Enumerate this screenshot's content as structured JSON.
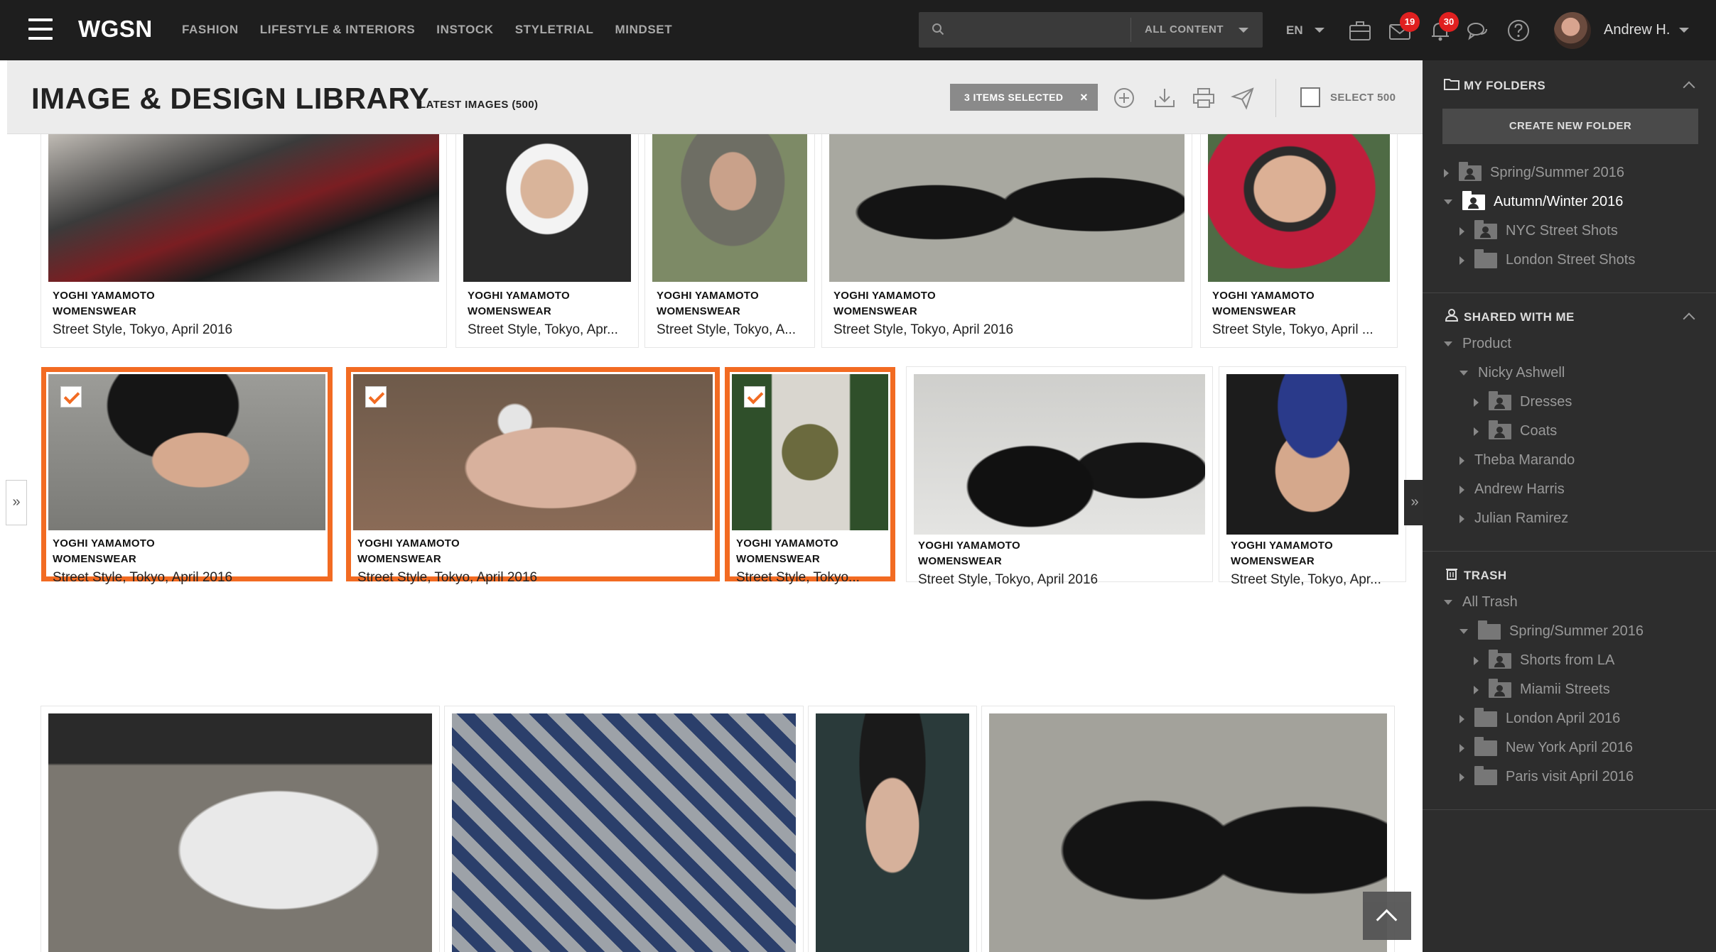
{
  "topbar": {
    "logo": "WGSN",
    "nav": [
      "FASHION",
      "LIFESTYLE & INTERIORS",
      "INSTOCK",
      "STYLETRIAL",
      "MINDSET"
    ],
    "search_placeholder": "",
    "search_scope": "ALL CONTENT",
    "language": "EN",
    "mail_badge": "19",
    "notifications_badge": "30",
    "user_name": "Andrew H.",
    "badge_color": "#e02020"
  },
  "library": {
    "title": "IMAGE & DESIGN LIBRARY",
    "subtitle": "LATEST IMAGES (500)",
    "selected_label": "3 ITEMS SELECTED",
    "select_all_label": "SELECT 500",
    "selection_color": "#f26b22"
  },
  "cards": [
    {
      "brand": "YOGHI YAMAMOTO",
      "category": "WOMENSWEAR",
      "caption": "Street Style, Tokyo, April 2016",
      "selected": false
    },
    {
      "brand": "YOGHI YAMAMOTO",
      "category": "WOMENSWEAR",
      "caption": "Street Style, Tokyo, Apr...",
      "selected": false
    },
    {
      "brand": "YOGHI YAMAMOTO",
      "category": "WOMENSWEAR",
      "caption": "Street Style, Tokyo, A...",
      "selected": false
    },
    {
      "brand": "YOGHI YAMAMOTO",
      "category": "WOMENSWEAR",
      "caption": "Street Style, Tokyo, April 2016",
      "selected": false
    },
    {
      "brand": "YOGHI YAMAMOTO",
      "category": "WOMENSWEAR",
      "caption": "Street Style, Tokyo, April ...",
      "selected": false
    },
    {
      "brand": "YOGHI YAMAMOTO",
      "category": "WOMENSWEAR",
      "caption": "Street Style, Tokyo, April 2016",
      "selected": true
    },
    {
      "brand": "YOGHI YAMAMOTO",
      "category": "WOMENSWEAR",
      "caption": "Street Style, Tokyo, April 2016",
      "selected": true
    },
    {
      "brand": "YOGHI YAMAMOTO",
      "category": "WOMENSWEAR",
      "caption": "Street Style, Tokyo...",
      "selected": true
    },
    {
      "brand": "YOGHI YAMAMOTO",
      "category": "WOMENSWEAR",
      "caption": "Street Style, Tokyo, April 2016",
      "selected": false
    },
    {
      "brand": "YOGHI YAMAMOTO",
      "category": "WOMENSWEAR",
      "caption": "Street Style, Tokyo, Apr...",
      "selected": false
    }
  ],
  "panel": {
    "my_folders": {
      "title": "MY FOLDERS",
      "create_label": "CREATE NEW FOLDER",
      "items": [
        {
          "label": "Spring/Summer 2016"
        },
        {
          "label": "Autumn/Winter 2016"
        },
        {
          "label": "NYC Street Shots"
        },
        {
          "label": "London Street Shots"
        }
      ]
    },
    "shared": {
      "title": "SHARED WITH ME",
      "items": [
        {
          "label": "Product"
        },
        {
          "label": "Nicky Ashwell"
        },
        {
          "label": "Dresses"
        },
        {
          "label": "Coats"
        },
        {
          "label": "Theba Marando"
        },
        {
          "label": "Andrew Harris"
        },
        {
          "label": "Julian Ramirez"
        }
      ]
    },
    "trash": {
      "title": "TRASH",
      "items": [
        {
          "label": "All Trash"
        },
        {
          "label": "Spring/Summer 2016"
        },
        {
          "label": "Shorts from LA"
        },
        {
          "label": "Miamii Streets"
        },
        {
          "label": "London April 2016"
        },
        {
          "label": "New York April 2016"
        },
        {
          "label": "Paris visit April 2016"
        }
      ]
    }
  }
}
